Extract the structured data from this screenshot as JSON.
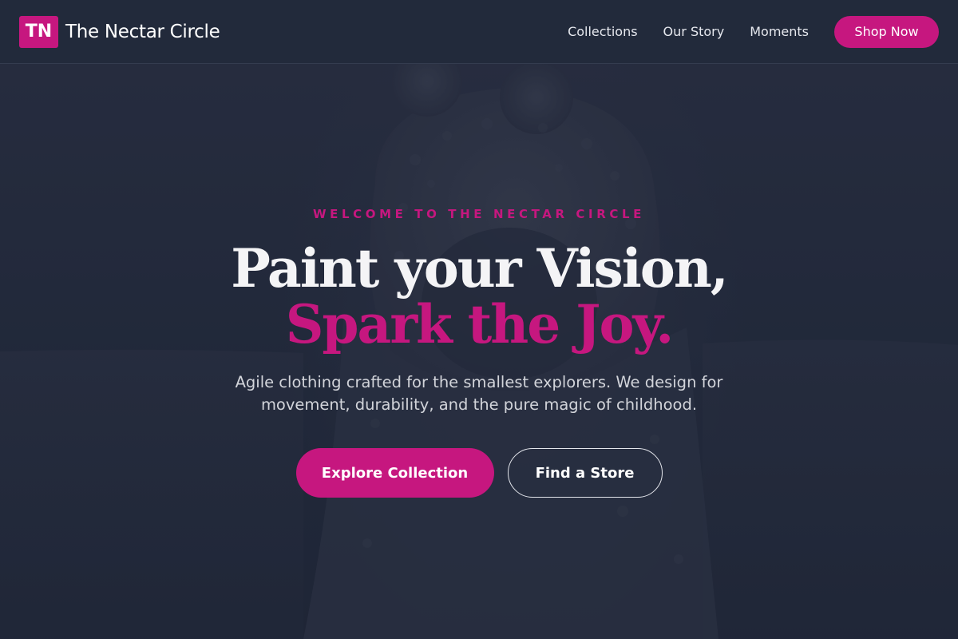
{
  "brand": {
    "logo_text": "TN",
    "name": "The Nectar Circle"
  },
  "nav": {
    "links": [
      "Collections",
      "Our Story",
      "Moments"
    ],
    "cta_label": "Shop Now"
  },
  "hero": {
    "eyebrow": "WELCOME TO THE NECTAR CIRCLE",
    "headline_line1": "Paint your Vision,",
    "headline_line2": "Spark the Joy.",
    "subtext": "Agile clothing crafted for the smallest explorers. We design for movement, durability, and the pure magic of childhood.",
    "primary_button": "Explore Collection",
    "secondary_button": "Find a Store",
    "background_image": "child-in-fuzzy-bear-hood-photo"
  },
  "colors": {
    "accent": "#c6177f",
    "navbar_bg": "#222a3b",
    "hero_bg": "#1f2637",
    "text_light": "#f4f4f6"
  }
}
